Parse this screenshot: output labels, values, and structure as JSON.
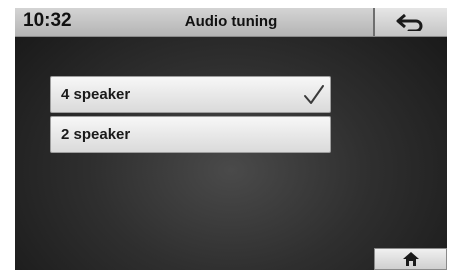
{
  "header": {
    "time": "10:32",
    "title": "Audio tuning",
    "back_icon": "back-arrow-icon"
  },
  "options": [
    {
      "label": "4 speaker",
      "selected": true
    },
    {
      "label": "2 speaker",
      "selected": false
    }
  ],
  "footer": {
    "home_icon": "home-icon"
  }
}
